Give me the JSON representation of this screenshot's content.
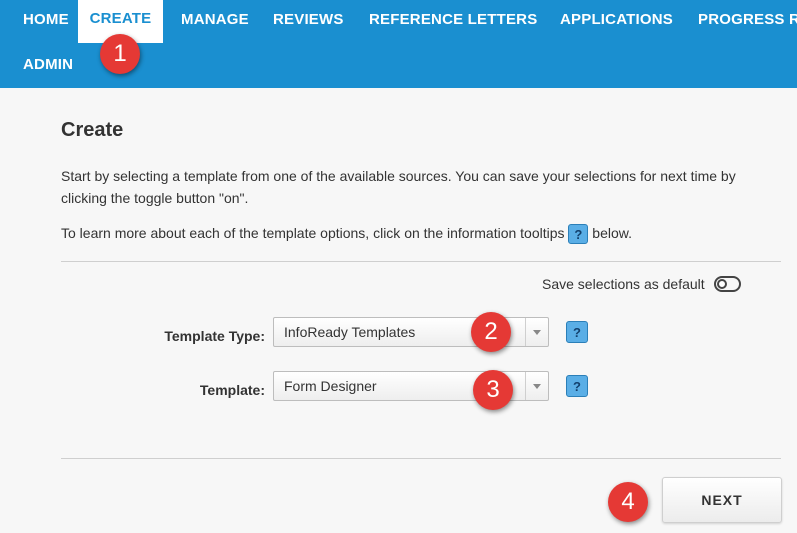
{
  "nav": {
    "items": [
      {
        "label": "HOME"
      },
      {
        "label": "CREATE"
      },
      {
        "label": "MANAGE"
      },
      {
        "label": "REVIEWS"
      },
      {
        "label": "REFERENCE LETTERS"
      },
      {
        "label": "APPLICATIONS"
      },
      {
        "label": "PROGRESS R"
      },
      {
        "label": "ADMIN"
      }
    ],
    "active": "CREATE"
  },
  "page": {
    "title": "Create",
    "intro_line1": "Start by selecting a template from one of the available sources. You can save your selections for next time by",
    "intro_line2": "clicking the toggle button \"on\".",
    "tooltip_pre": "To learn more about each of the template options, click on the information tooltips",
    "tooltip_post": "below.",
    "help_glyph": "?"
  },
  "save_default": {
    "label": "Save selections as default",
    "on": false
  },
  "fields": {
    "template_type": {
      "label": "Template Type:",
      "value": "InfoReady Templates"
    },
    "template": {
      "label": "Template:",
      "value": "Form Designer"
    }
  },
  "next_label": "NEXT",
  "markers": [
    "1",
    "2",
    "3",
    "4"
  ],
  "colors": {
    "nav_bg": "#1a8fd0",
    "marker": "#e53935",
    "help": "#5aaee6"
  }
}
